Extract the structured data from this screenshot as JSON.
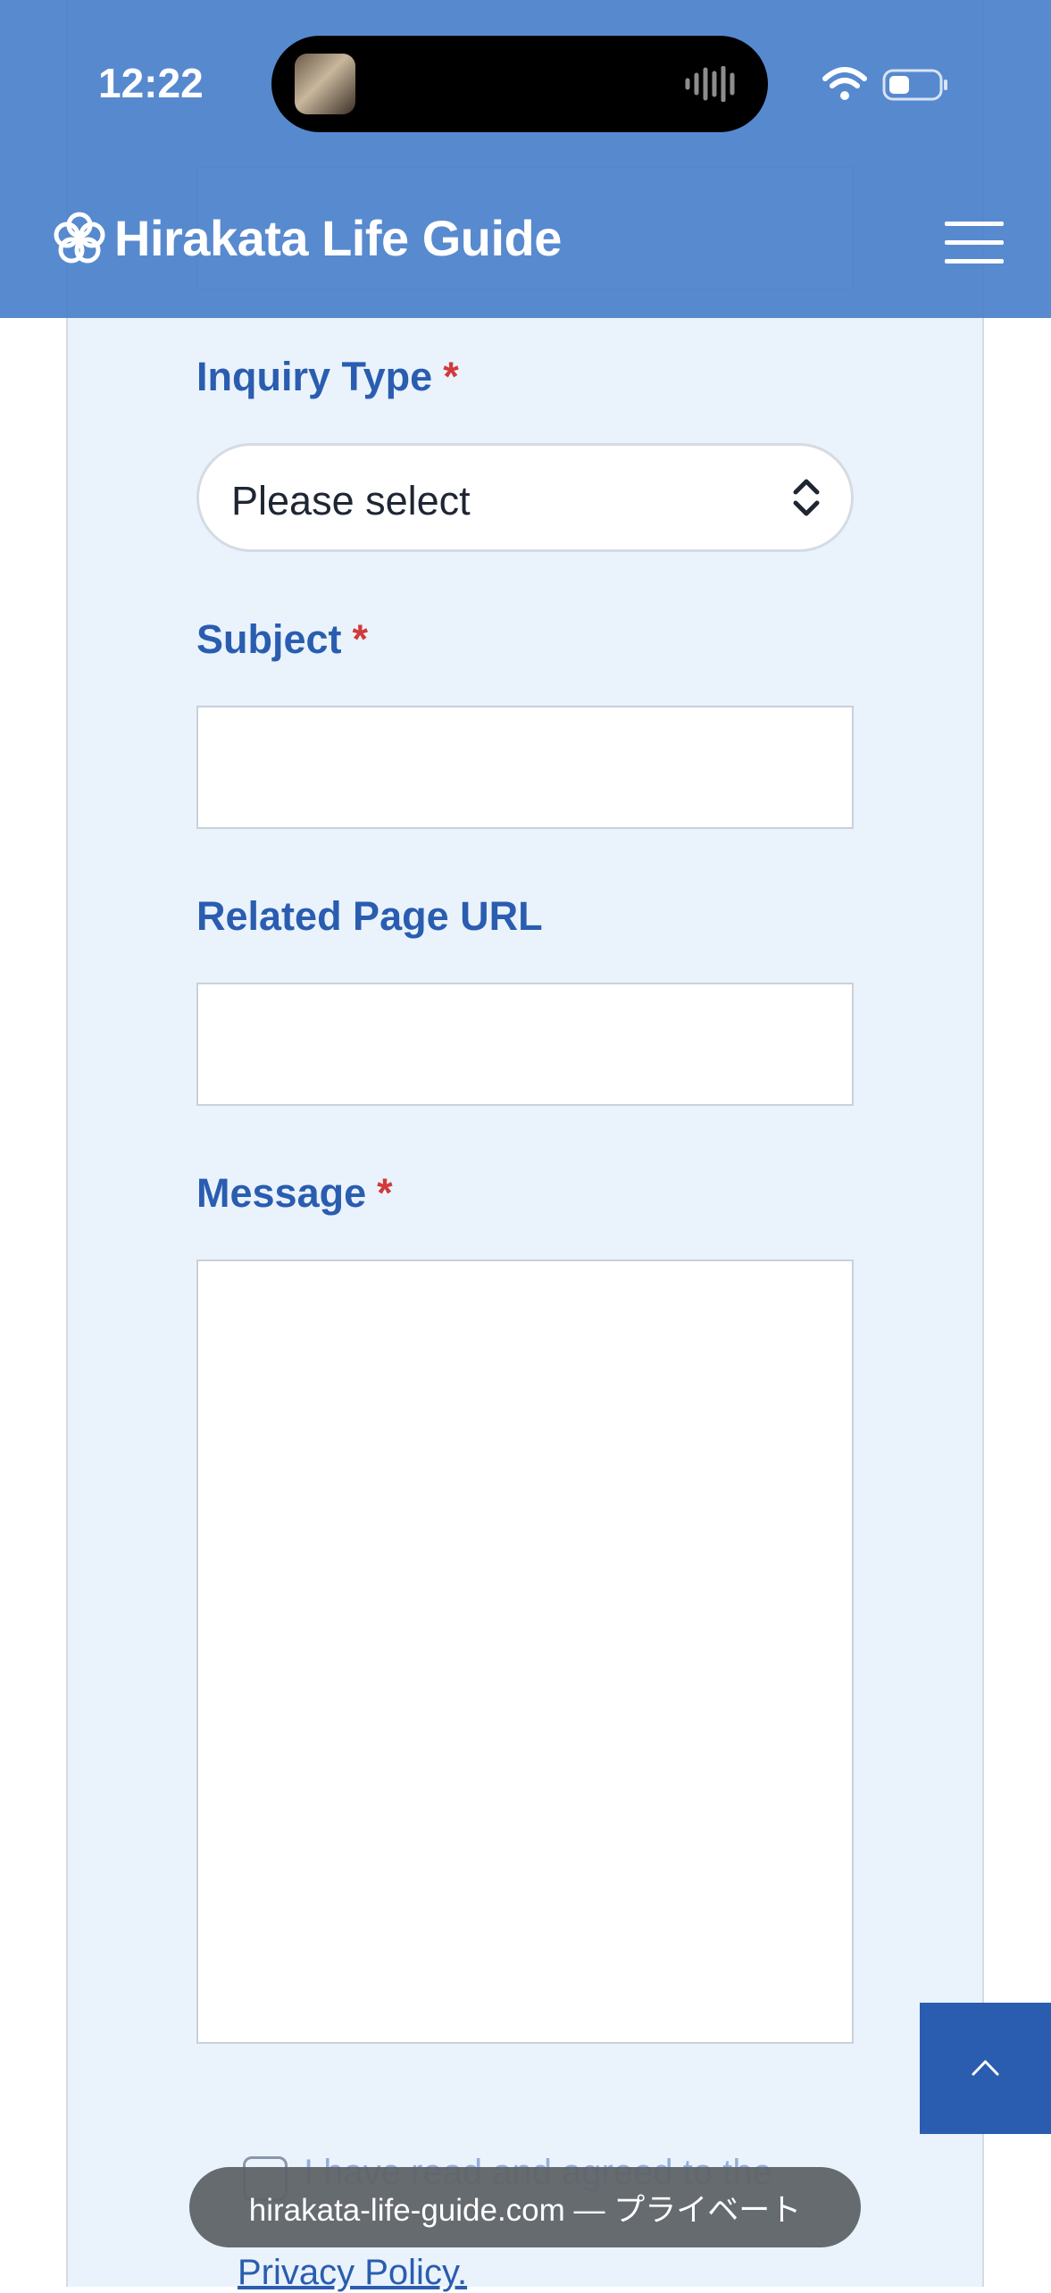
{
  "status_bar": {
    "time": "12:22"
  },
  "header": {
    "site_name": "Hirakata Life Guide"
  },
  "form": {
    "inquiry_type": {
      "label": "Inquiry Type",
      "required_mark": "*",
      "selected": "Please select"
    },
    "subject": {
      "label": "Subject",
      "required_mark": "*",
      "value": ""
    },
    "related_url": {
      "label": "Related Page URL",
      "value": ""
    },
    "message": {
      "label": "Message",
      "required_mark": "*",
      "value": ""
    },
    "consent_text": "I have read and agreed to the",
    "privacy_link": "Privacy Policy."
  },
  "browser": {
    "url_label": "hirakata-life-guide.com — プライベート"
  },
  "colors": {
    "header": "#4a80cb",
    "accent": "#2a5db0",
    "required": "#d13a3a",
    "card": "#eaf3fc"
  }
}
